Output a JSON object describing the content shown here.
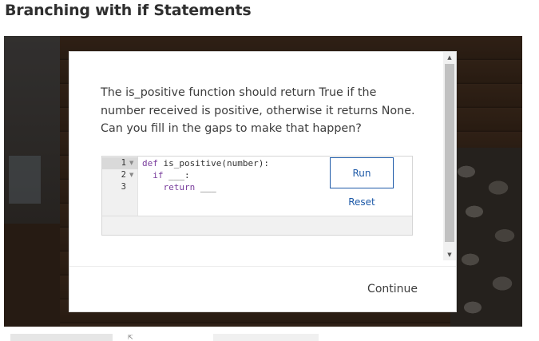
{
  "page": {
    "title": "Branching with if Statements"
  },
  "modal": {
    "question": "The is_positive function should return True if the number received is positive, otherwise it returns None. Can you fill in the gaps to make that happen?",
    "editor": {
      "line_numbers": [
        "1",
        "2",
        "3"
      ],
      "lines": [
        {
          "keyword": "def",
          "rest": " is_positive(number):"
        },
        {
          "indent": "  ",
          "keyword": "if",
          "rest": " ___:"
        },
        {
          "indent": "    ",
          "keyword": "return",
          "rest": " ___"
        }
      ]
    },
    "run_label": "Run",
    "reset_label": "Reset",
    "continue_label": "Continue"
  },
  "colors": {
    "link_blue": "#1e5aa8",
    "keyword_purple": "#7a3e9d"
  }
}
